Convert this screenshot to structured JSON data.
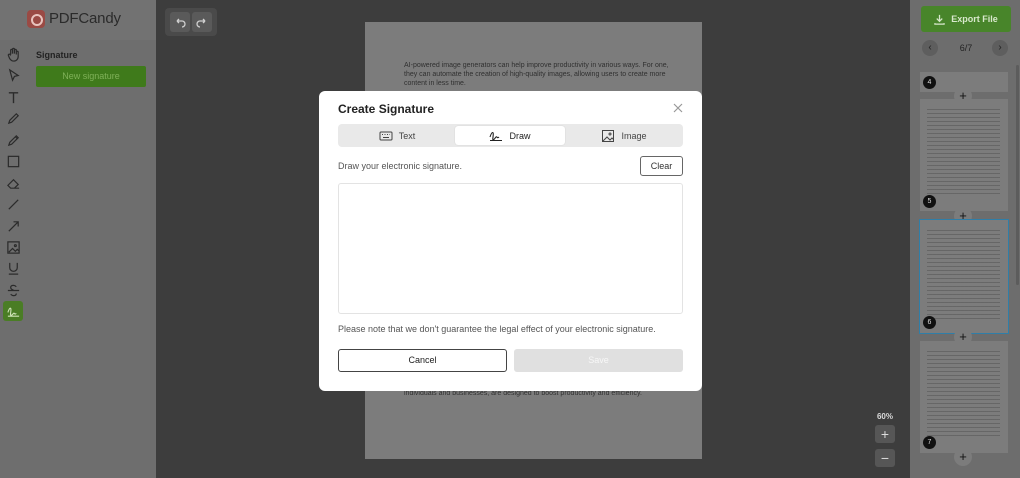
{
  "app": {
    "logo_text": "PDFCandy"
  },
  "toolbar": {
    "tools": [
      "hand-icon",
      "pointer-icon",
      "text-icon",
      "pen-icon",
      "pencil-icon",
      "rectangle-icon",
      "eraser-icon",
      "line-icon",
      "arrow-icon",
      "image-icon",
      "underline-icon",
      "strikethrough-icon",
      "signature-icon"
    ],
    "active_tool": "signature-icon"
  },
  "signature_panel": {
    "title": "Signature",
    "new_button": "New signature"
  },
  "document": {
    "paragraph_1": "AI-powered image generators can help improve productivity in various ways. For one, they can automate the creation of high-quality images, allowing users to create more content in less time.",
    "paragraph_2": "individuals and businesses, are designed to boost productivity and efficiency."
  },
  "zoom": {
    "level": "60%",
    "in_label": "+",
    "out_label": "−"
  },
  "right_panel": {
    "export_label": "Export File",
    "page_counter": "6/7",
    "thumbnails": [
      {
        "number": "4"
      },
      {
        "number": "5"
      },
      {
        "number": "6"
      },
      {
        "number": "7"
      }
    ],
    "selected_page": "6",
    "add_label": "+"
  },
  "modal": {
    "title": "Create Signature",
    "tabs": [
      {
        "label": "Text",
        "icon": "keyboard-icon"
      },
      {
        "label": "Draw",
        "icon": "signature-draw-icon"
      },
      {
        "label": "Image",
        "icon": "image-icon"
      }
    ],
    "active_tab": "Draw",
    "instruction": "Draw your electronic signature.",
    "clear_label": "Clear",
    "note": "Please note that we don't guarantee the legal effect of your electronic signature.",
    "cancel_label": "Cancel",
    "save_label": "Save"
  },
  "colors": {
    "accent_green": "#4caf50",
    "selected_blue": "#2f9bd6",
    "overlay": "rgba(0,0,0,0.55)"
  }
}
